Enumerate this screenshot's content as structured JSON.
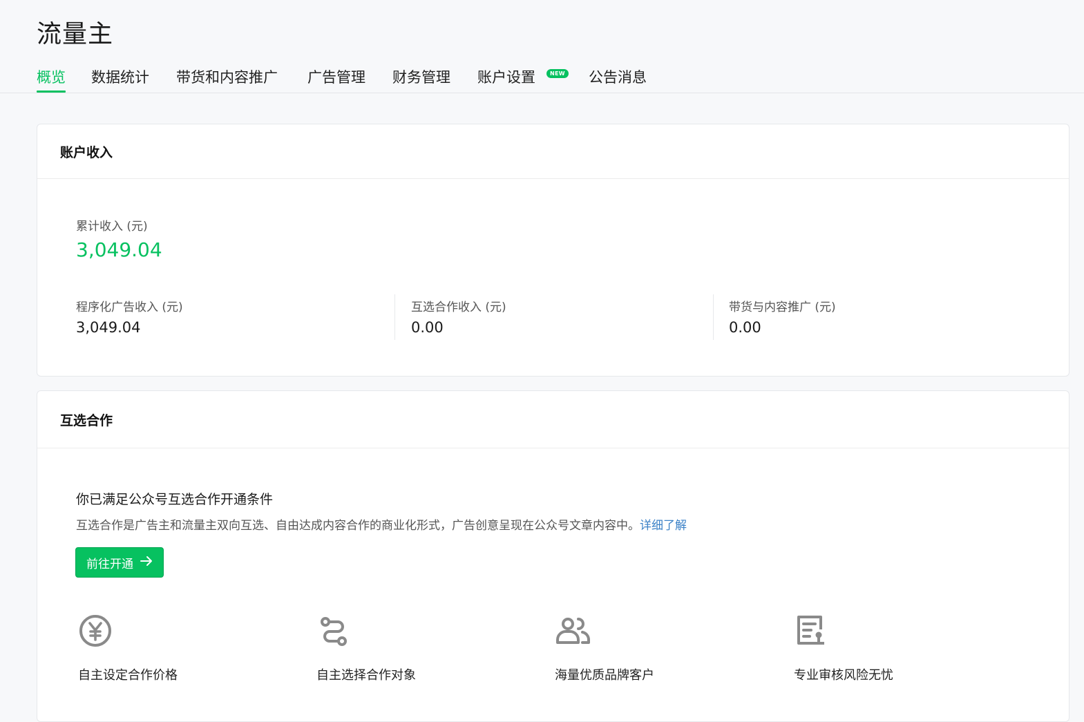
{
  "header": {
    "title": "流量主"
  },
  "tabs": [
    {
      "label": "概览",
      "active": true
    },
    {
      "label": "数据统计"
    },
    {
      "label": "带货和内容推广"
    },
    {
      "label": "广告管理"
    },
    {
      "label": "财务管理"
    },
    {
      "label": "账户设置",
      "badge": "NEW"
    },
    {
      "label": "公告消息"
    }
  ],
  "income": {
    "title": "账户收入",
    "total_label": "累计收入 (元)",
    "total_value": "3,049.04",
    "items": [
      {
        "label": "程序化广告收入 (元)",
        "value": "3,049.04"
      },
      {
        "label": "互选合作收入 (元)",
        "value": "0.00"
      },
      {
        "label": "带货与内容推广 (元)",
        "value": "0.00"
      }
    ]
  },
  "cooperation": {
    "title": "互选合作",
    "headline": "你已满足公众号互选合作开通条件",
    "description": "互选合作是广告主和流量主双向互选、自由达成内容合作的商业化形式，广告创意呈现在公众号文章内容中。",
    "learn_more": "详细了解",
    "button_label": "前往开通",
    "features": [
      {
        "icon": "yuan-coin-icon",
        "label": "自主设定合作价格"
      },
      {
        "icon": "route-icon",
        "label": "自主选择合作对象"
      },
      {
        "icon": "users-icon",
        "label": "海量优质品牌客户"
      },
      {
        "icon": "document-review-icon",
        "label": "专业审核风险无忧"
      }
    ]
  },
  "colors": {
    "accent": "#07c160",
    "link": "#3c82c7"
  }
}
